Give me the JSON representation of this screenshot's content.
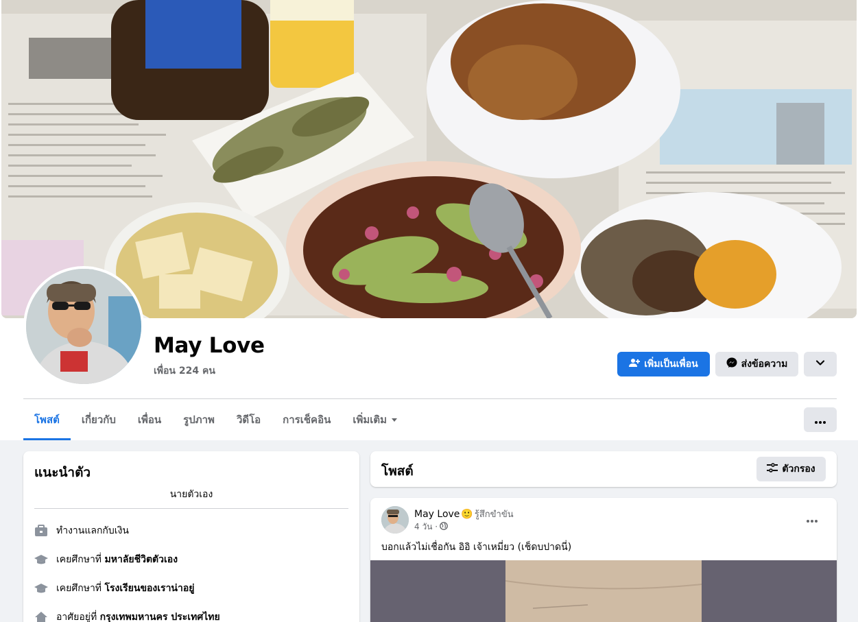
{
  "profile": {
    "name": "May Love",
    "friends": "เพื่อน 224 คน"
  },
  "actions": {
    "add_friend": "เพิ่มเป็นเพื่อน",
    "message": "ส่งข้อความ"
  },
  "tabs": [
    {
      "label": "โพสต์",
      "active": true
    },
    {
      "label": "เกี่ยวกับ",
      "active": false
    },
    {
      "label": "เพื่อน",
      "active": false
    },
    {
      "label": "รูปภาพ",
      "active": false
    },
    {
      "label": "วิดีโอ",
      "active": false
    },
    {
      "label": "การเช็คอิน",
      "active": false
    },
    {
      "label": "เพิ่มเติม",
      "active": false
    }
  ],
  "intro": {
    "title": "แนะนำตัว",
    "bio": "นายตัวเอง",
    "items": [
      {
        "icon": "briefcase-icon",
        "prefix": "ทำงานแลกกับเงิน",
        "bold": ""
      },
      {
        "icon": "graduation-cap-icon",
        "prefix": "เคยศึกษาที่ ",
        "bold": "มหาลัยชีวิตตัวเอง"
      },
      {
        "icon": "graduation-cap-icon",
        "prefix": "เคยศึกษาที่ ",
        "bold": "โรงเรียนของเราน่าอยู่"
      },
      {
        "icon": "home-icon",
        "prefix": "อาศัยอยู่ที่ ",
        "bold": "กรุงเทพมหานคร ประเทศไทย"
      }
    ]
  },
  "posts": {
    "title": "โพสต์",
    "filter": "ตัวกรอง"
  },
  "post": {
    "author": "May Love",
    "emoji": "🙂",
    "feeling": "รู้สึกขำขัน",
    "time": "4 วัน ·",
    "text": "บอกแล้วไม่เชื่อกัน อิอิ เจ้าเหมี่ยว (เช็ดบปาดนี่)"
  },
  "colors": {
    "accent": "#1b74e4",
    "background": "#f0f2f5",
    "secondary_button": "#e4e6eb"
  }
}
